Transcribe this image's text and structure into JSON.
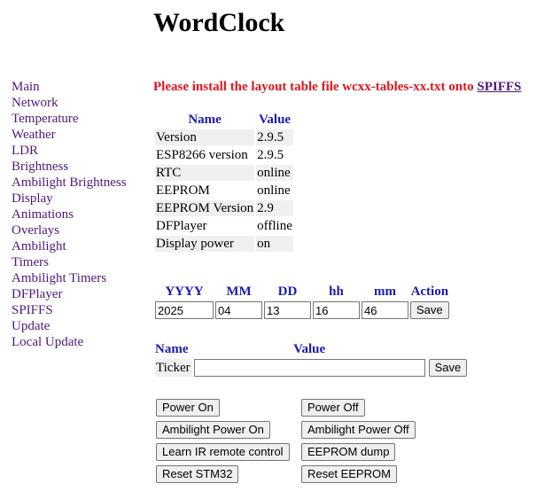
{
  "page": {
    "title": "WordClock"
  },
  "nav": [
    {
      "label": "Main"
    },
    {
      "label": "Network"
    },
    {
      "label": "Temperature"
    },
    {
      "label": "Weather"
    },
    {
      "label": "LDR"
    },
    {
      "label": "Brightness"
    },
    {
      "label": "Ambilight Brightness"
    },
    {
      "label": "Display"
    },
    {
      "label": "Animations"
    },
    {
      "label": "Overlays"
    },
    {
      "label": "Ambilight"
    },
    {
      "label": "Timers"
    },
    {
      "label": "Ambilight Timers"
    },
    {
      "label": "DFPlayer"
    },
    {
      "label": "SPIFFS"
    },
    {
      "label": "Update"
    },
    {
      "label": "Local Update"
    }
  ],
  "warning": {
    "text": "Please install the layout table file wcxx-tables-xx.txt onto ",
    "link": "SPIFFS"
  },
  "info": {
    "headers": {
      "name": "Name",
      "value": "Value"
    },
    "rows": [
      {
        "name": "Version",
        "value": "2.9.5"
      },
      {
        "name": "ESP8266 version",
        "value": "2.9.5"
      },
      {
        "name": "RTC",
        "value": "online"
      },
      {
        "name": "EEPROM",
        "value": "online"
      },
      {
        "name": "EEPROM Version",
        "value": "2.9"
      },
      {
        "name": "DFPlayer",
        "value": "offline"
      },
      {
        "name": "Display power",
        "value": "on"
      }
    ]
  },
  "datetime": {
    "headers": {
      "yyyy": "YYYY",
      "mm": "MM",
      "dd": "DD",
      "hh": "hh",
      "min": "mm",
      "action": "Action"
    },
    "values": {
      "yyyy": "2025",
      "mm": "04",
      "dd": "13",
      "hh": "16",
      "min": "46"
    },
    "save_label": "Save"
  },
  "ticker": {
    "headers": {
      "name": "Name",
      "value": "Value"
    },
    "label": "Ticker",
    "value": "",
    "save_label": "Save"
  },
  "actions": {
    "power_on": "Power On",
    "power_off": "Power Off",
    "ambilight_on": "Ambilight Power On",
    "ambilight_off": "Ambilight Power Off",
    "learn_ir": "Learn IR remote control",
    "eeprom_dump": "EEPROM dump",
    "reset_stm32": "Reset STM32",
    "reset_eeprom": "Reset EEPROM"
  }
}
